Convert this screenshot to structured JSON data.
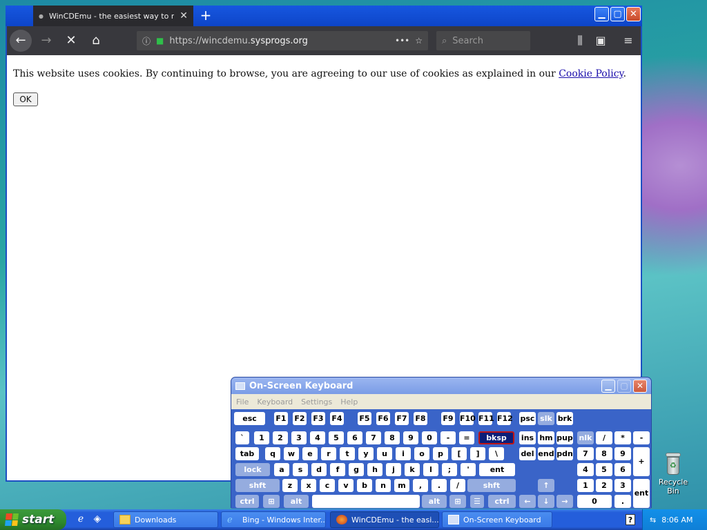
{
  "desktop": {
    "recycle_bin_label": "Recycle Bin"
  },
  "browser": {
    "tab_title": "WinCDEmu - the easiest way to m",
    "url_prefix": "https://wincdemu.",
    "url_domain": "sysprogs.org",
    "url_more": "•••",
    "search_placeholder": "Search",
    "cookie_text": "This website uses cookies. By continuing to browse, you are agreeing to our use of cookies as explained in our ",
    "cookie_link": "Cookie Policy",
    "cookie_end": ".",
    "ok_label": "OK"
  },
  "osk": {
    "title": "On-Screen Keyboard",
    "menu": [
      "File",
      "Keyboard",
      "Settings",
      "Help"
    ],
    "keys": [
      {
        "l": "esc"
      },
      {
        "l": "F1"
      },
      {
        "l": "F2"
      },
      {
        "l": "F3"
      },
      {
        "l": "F4"
      },
      {
        "l": "F5"
      },
      {
        "l": "F6"
      },
      {
        "l": "F7"
      },
      {
        "l": "F8"
      },
      {
        "l": "F9"
      },
      {
        "l": "F10"
      },
      {
        "l": "F11"
      },
      {
        "l": "F12"
      },
      {
        "l": "psc"
      },
      {
        "l": "slk"
      },
      {
        "l": "brk"
      },
      {
        "l": "`"
      },
      {
        "l": "1"
      },
      {
        "l": "2"
      },
      {
        "l": "3"
      },
      {
        "l": "4"
      },
      {
        "l": "5"
      },
      {
        "l": "6"
      },
      {
        "l": "7"
      },
      {
        "l": "8"
      },
      {
        "l": "9"
      },
      {
        "l": "0"
      },
      {
        "l": "-"
      },
      {
        "l": "="
      },
      {
        "l": "bksp"
      },
      {
        "l": "ins"
      },
      {
        "l": "hm"
      },
      {
        "l": "pup"
      },
      {
        "l": "nlk"
      },
      {
        "l": "/"
      },
      {
        "l": "*"
      },
      {
        "l": "-"
      },
      {
        "l": "tab"
      },
      {
        "l": "q"
      },
      {
        "l": "w"
      },
      {
        "l": "e"
      },
      {
        "l": "r"
      },
      {
        "l": "t"
      },
      {
        "l": "y"
      },
      {
        "l": "u"
      },
      {
        "l": "i"
      },
      {
        "l": "o"
      },
      {
        "l": "p"
      },
      {
        "l": "["
      },
      {
        "l": "]"
      },
      {
        "l": "\\"
      },
      {
        "l": "del"
      },
      {
        "l": "end"
      },
      {
        "l": "pdn"
      },
      {
        "l": "7"
      },
      {
        "l": "8"
      },
      {
        "l": "9"
      },
      {
        "l": "+"
      },
      {
        "l": "lock"
      },
      {
        "l": "a"
      },
      {
        "l": "s"
      },
      {
        "l": "d"
      },
      {
        "l": "f"
      },
      {
        "l": "g"
      },
      {
        "l": "h"
      },
      {
        "l": "j"
      },
      {
        "l": "k"
      },
      {
        "l": "l"
      },
      {
        "l": ";"
      },
      {
        "l": "'"
      },
      {
        "l": "ent"
      },
      {
        "l": "4"
      },
      {
        "l": "5"
      },
      {
        "l": "6"
      },
      {
        "l": "shft"
      },
      {
        "l": "z"
      },
      {
        "l": "x"
      },
      {
        "l": "c"
      },
      {
        "l": "v"
      },
      {
        "l": "b"
      },
      {
        "l": "n"
      },
      {
        "l": "m"
      },
      {
        "l": ","
      },
      {
        "l": "."
      },
      {
        "l": "/"
      },
      {
        "l": "shft"
      },
      {
        "l": "↑"
      },
      {
        "l": "1"
      },
      {
        "l": "2"
      },
      {
        "l": "3"
      },
      {
        "l": "ent"
      },
      {
        "l": "ctrl"
      },
      {
        "l": "win"
      },
      {
        "l": "alt"
      },
      {
        "l": ""
      },
      {
        "l": "alt"
      },
      {
        "l": "win"
      },
      {
        "l": "menu"
      },
      {
        "l": "ctrl"
      },
      {
        "l": "←"
      },
      {
        "l": "↓"
      },
      {
        "l": "→"
      },
      {
        "l": "0"
      },
      {
        "l": "."
      }
    ]
  },
  "taskbar": {
    "start_label": "start",
    "buttons": [
      {
        "label": "Downloads"
      },
      {
        "label": "Bing - Windows Inter..."
      },
      {
        "label": "WinCDEmu - the easi..."
      },
      {
        "label": "On-Screen Keyboard"
      }
    ],
    "clock": "8:06 AM"
  }
}
